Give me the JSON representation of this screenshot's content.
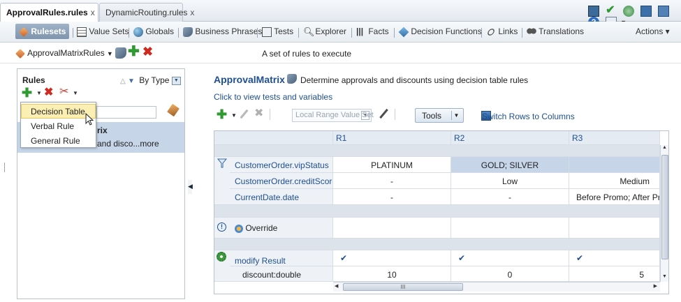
{
  "tabs": [
    {
      "label": "ApprovalRules.rules",
      "close": "x"
    },
    {
      "label": "DynamicRouting.rules",
      "close": "x"
    }
  ],
  "nav": {
    "items": [
      "Rulesets",
      "Value Sets",
      "Globals",
      "Business Phrases",
      "Tests",
      "Explorer",
      "Facts",
      "Decision Functions",
      "Links",
      "Translations"
    ],
    "actions": "Actions ▾"
  },
  "ruleset": {
    "name": "ApprovalMatrixRules",
    "description": "A set of rules to execute"
  },
  "left": {
    "title": "Rules",
    "sort_label": "By Type",
    "selected_line1": "rix",
    "selected_line2": "and disco...more",
    "dropdown": [
      "Decision Table",
      "Verbal Rule",
      "General Rule"
    ]
  },
  "main": {
    "title": "ApprovalMatrix",
    "description": "Determine approvals and discounts using decision table rules",
    "link": "Click to view tests and variables",
    "value_set_placeholder": "Local Range Value Set",
    "tools_label": "Tools",
    "switch_label": "Switch Rows to Columns"
  },
  "table": {
    "columns": [
      "R1",
      "R2",
      "R3"
    ],
    "conditions": [
      {
        "label": "CustomerOrder.vipStatus",
        "r1": "PLATINUM",
        "r23": "GOLD; SILVER"
      },
      {
        "label": "CustomerOrder.creditScore",
        "r1": "-",
        "r2": "Low",
        "r3": "Medium"
      },
      {
        "label": "CurrentDate.date",
        "r1": "-",
        "r2": "-",
        "r3": "Before Promo; After Pr"
      }
    ],
    "override_label": "Override",
    "action_label": "modify Result",
    "action_checks": [
      "✔",
      "✔",
      "✔"
    ],
    "param_label": "discount:double",
    "param_values": [
      "10",
      "0",
      "5"
    ],
    "scroll_mark": "III"
  },
  "colors": {
    "accent_blue": "#1d4f91",
    "selection": "#c6d5e8",
    "hover": "#fcefb4",
    "header_bg": "#e4ebf3"
  }
}
